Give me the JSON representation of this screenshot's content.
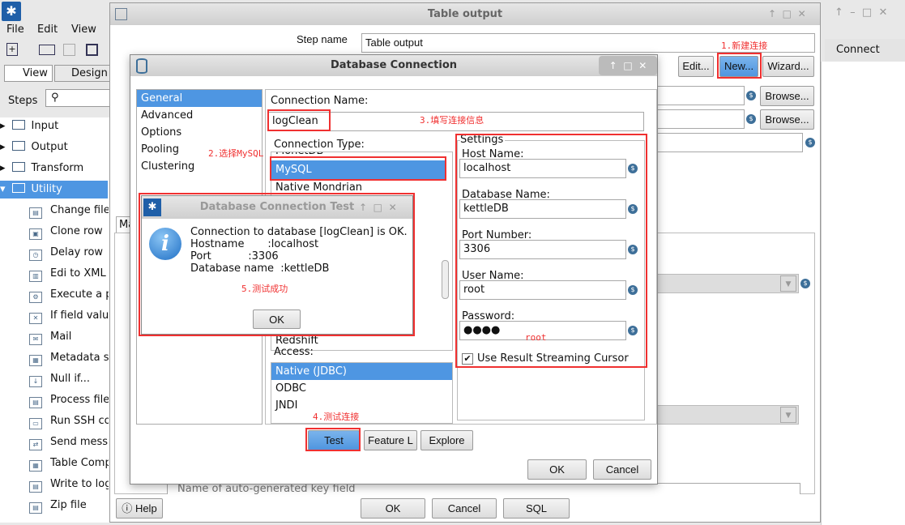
{
  "app": {
    "menu": [
      "File",
      "Edit",
      "View"
    ],
    "tabs": [
      "View",
      "Design"
    ],
    "steps_label": "Steps",
    "tree": [
      {
        "label": "Input"
      },
      {
        "label": "Output"
      },
      {
        "label": "Transform"
      },
      {
        "label": "Utility"
      }
    ],
    "utility_items": [
      "Change file",
      "Clone row",
      "Delay row",
      "Edi to XML",
      "Execute a p",
      "If field valu",
      "Mail",
      "Metadata s",
      "Null if...",
      "Process file",
      "Run SSH co",
      "Send mess",
      "Table Comp",
      "Write to log",
      "Zip file"
    ],
    "connect_tab": "Connect"
  },
  "table_output": {
    "title": "Table output",
    "step_name_label": "Step name",
    "step_name_value": "Table output",
    "edit": "Edit...",
    "new": "New...",
    "wizard": "Wizard...",
    "browse": "Browse...",
    "tab_partial": "Ma",
    "key_field_label": "Name of auto-generated key field",
    "help": "Help",
    "ok": "OK",
    "cancel": "Cancel",
    "sql": "SQL"
  },
  "db_conn": {
    "title": "Database Connection",
    "nav": [
      "General",
      "Advanced",
      "Options",
      "Pooling",
      "Clustering"
    ],
    "selected_nav": "General",
    "conn_name_label": "Connection Name:",
    "conn_name_value": "logClean",
    "conn_type_label": "Connection Type:",
    "types": [
      "MonetDB",
      "MySQL",
      "Native Mondrian",
      "Redshift"
    ],
    "selected_type": "MySQL",
    "access_label": "Access:",
    "access": [
      "Native (JDBC)",
      "ODBC",
      "JNDI"
    ],
    "selected_access": "Native (JDBC)",
    "settings_label": "Settings",
    "fields": [
      {
        "label": "Host Name:",
        "value": "localhost"
      },
      {
        "label": "Database Name:",
        "value": "kettleDB"
      },
      {
        "label": "Port Number:",
        "value": "3306"
      },
      {
        "label": "User Name:",
        "value": "root"
      },
      {
        "label": "Password:",
        "value": "●●●●"
      }
    ],
    "streaming_label": "Use Result Streaming Cursor",
    "streaming_checked": true,
    "test": "Test",
    "feature": "Feature L",
    "explore": "Explore",
    "ok": "OK",
    "cancel": "Cancel"
  },
  "test_dialog": {
    "title": "Database Connection Test",
    "lines": [
      "Connection to database [logClean] is OK.",
      "Hostname       :localhost",
      "Port           :3306",
      "Database name  :kettleDB"
    ],
    "ok": "OK"
  },
  "annotations": {
    "a1": "1.新建连接",
    "a2": "2.选择MySQL",
    "a3": "3.填写连接信息",
    "a4": "4.测试连接",
    "a5": "5.测试成功",
    "pw": "root"
  },
  "colors": {
    "accent": "#4e96e2",
    "annotation": "#f03030"
  }
}
